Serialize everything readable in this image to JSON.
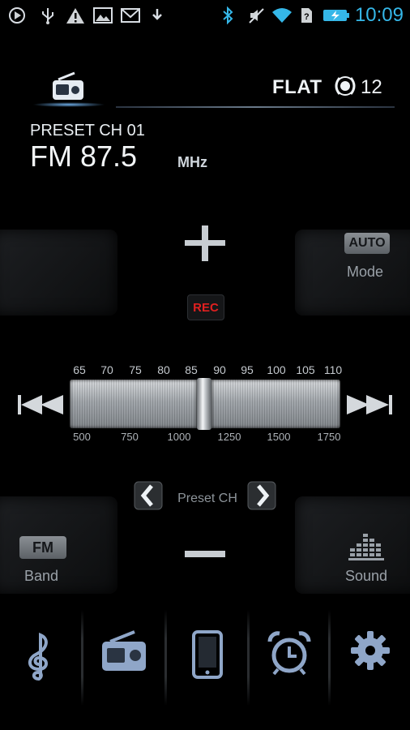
{
  "status_bar": {
    "time": "10:09",
    "icons": [
      "play-circle-icon",
      "usb-icon",
      "warning-icon",
      "image-icon",
      "mail-icon",
      "download-icon",
      "bluetooth-icon",
      "mute-icon",
      "wifi-icon",
      "no-sim-icon",
      "battery-charging-icon"
    ]
  },
  "header": {
    "eq_preset": "FLAT",
    "volume": "12"
  },
  "tuner": {
    "preset_label": "PRESET CH 01",
    "frequency": "FM 87.5",
    "unit": "MHz",
    "rec_label": "REC",
    "mode_badge": "AUTO",
    "mode_label": "Mode",
    "band_badge": "FM",
    "band_label": "Band",
    "sound_label": "Sound",
    "preset_ch_label": "Preset CH",
    "fm_scale": [
      "65",
      "70",
      "75",
      "80",
      "85",
      "90",
      "95",
      "100",
      "105",
      "110"
    ],
    "am_scale": [
      "500",
      "750",
      "1000",
      "1250",
      "1500",
      "1750"
    ]
  },
  "nav": {
    "items": [
      "music-icon",
      "radio-icon",
      "phone-icon",
      "alarm-icon",
      "settings-icon"
    ]
  },
  "colors": {
    "clock": "#35b7e8",
    "rec": "#e02020",
    "background": "#000000"
  }
}
